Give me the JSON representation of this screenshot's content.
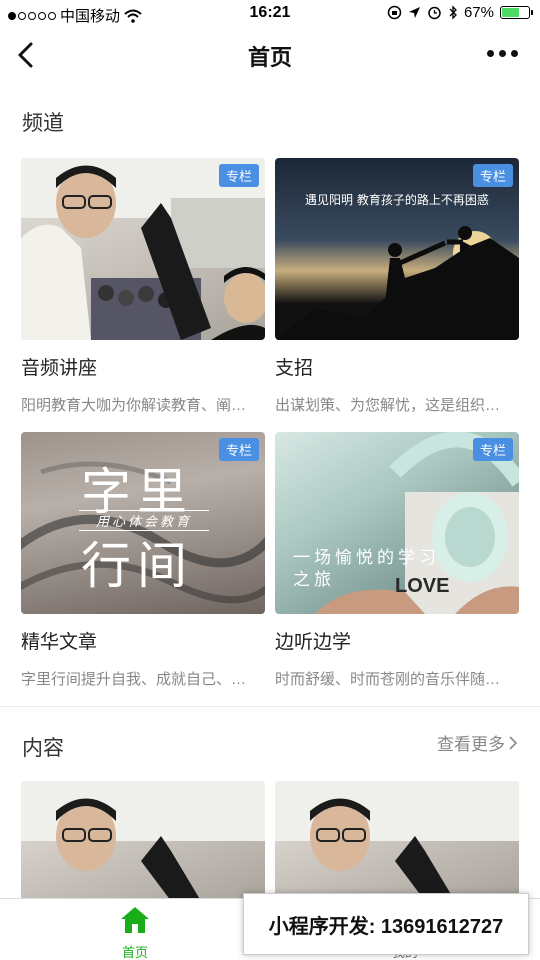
{
  "status": {
    "carrier": "中国移动",
    "time": "16:21",
    "battery": "67%",
    "battery_level": 0.67
  },
  "nav": {
    "title": "首页"
  },
  "channels": {
    "title": "频道",
    "items": [
      {
        "badge": "专栏",
        "title": "音频讲座",
        "desc": "阳明教育大咖为你解读教育、阐…"
      },
      {
        "badge": "专栏",
        "title": "支招",
        "desc": "出谋划策、为您解忧，这是组织…",
        "image_text": "遇见阳明   教育孩子的路上不再困惑"
      },
      {
        "badge": "专栏",
        "title": "精华文章",
        "desc": "字里行间提升自我、成就自己、…",
        "image_text_1": "字里",
        "image_text_2": "用心体会教育",
        "image_text_3": "行间"
      },
      {
        "badge": "专栏",
        "title": "边听边学",
        "desc": "时而舒缓、时而苍刚的音乐伴随…",
        "image_text": "一场愉悦的学习之旅"
      }
    ]
  },
  "content": {
    "title": "内容",
    "more": "查看更多"
  },
  "tabbar": {
    "home": "首页",
    "mine": "我的"
  },
  "watermark": "小程序开发: 13691612727"
}
